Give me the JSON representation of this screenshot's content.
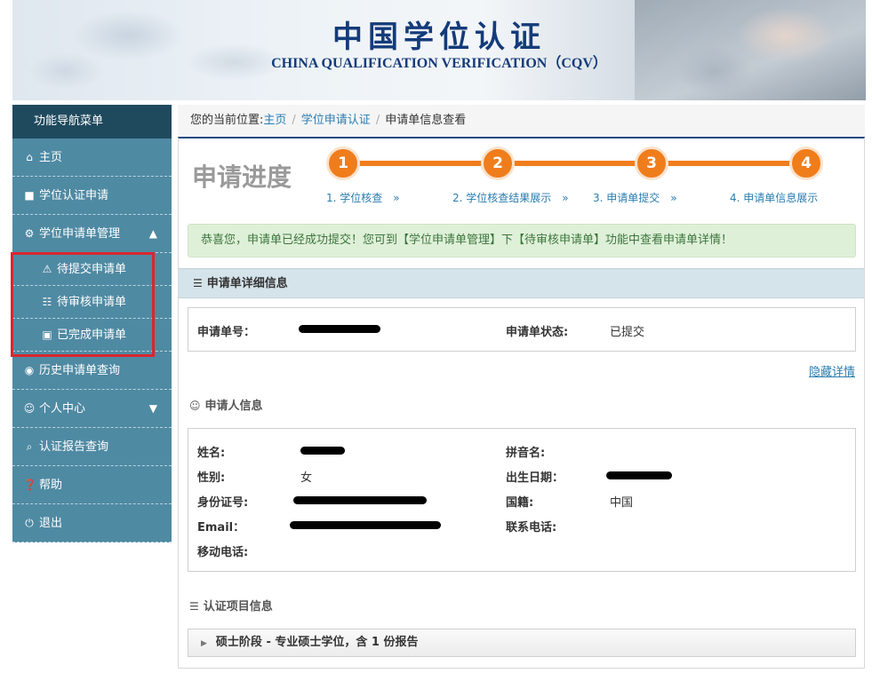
{
  "banner": {
    "title_cn": "中国学位认证",
    "title_en": "CHINA QUALIFICATION VERIFICATION（CQV）"
  },
  "sidebar": {
    "header": "功能导航菜单",
    "items": [
      {
        "label": "主页",
        "icon": "home-icon"
      },
      {
        "label": "学位认证申请",
        "icon": "file-icon"
      },
      {
        "label": "学位申请单管理",
        "icon": "gear-icon"
      },
      {
        "label": "历史申请单查询",
        "icon": "camera-icon"
      },
      {
        "label": "个人中心",
        "icon": "user-icon"
      },
      {
        "label": "认证报告查询",
        "icon": "search-icon"
      },
      {
        "label": "帮助",
        "icon": "question-icon"
      },
      {
        "label": "退出",
        "icon": "power-icon"
      }
    ],
    "subitems": [
      {
        "label": "待提交申请单",
        "icon": "warning-icon"
      },
      {
        "label": "待审核申请单",
        "icon": "cart-icon"
      },
      {
        "label": "已完成申请单",
        "icon": "briefcase-icon"
      }
    ]
  },
  "breadcrumb": {
    "prefix": "您的当前位置:",
    "home": "主页",
    "level2": "学位申请认证",
    "current": "申请单信息查看",
    "separator": "/"
  },
  "progress": {
    "title": "申请进度",
    "steps": [
      {
        "num": "1",
        "label": "1. 学位核查　»"
      },
      {
        "num": "2",
        "label": "2. 学位核查结果展示　»"
      },
      {
        "num": "3",
        "label": "3. 申请单提交　»"
      },
      {
        "num": "4",
        "label": "4. 申请单信息展示"
      }
    ],
    "color": "#f07d1c"
  },
  "alert": "恭喜您，申请单已经成功提交！您可到【学位申请单管理】下【待审核申请单】功能中查看申请单详情！",
  "detail": {
    "section_title": "申请单详细信息",
    "order_no_label": "申请单号：",
    "status_label": "申请单状态:",
    "status_value": "已提交",
    "hide_link": "隐藏详情"
  },
  "applicant": {
    "title": "申请人信息",
    "fields": {
      "name_label": "姓名:",
      "pinyin_label": "拼音名:",
      "gender_label": "性别:",
      "gender_value": "女",
      "birth_label": "出生日期：",
      "id_label": "身份证号:",
      "nationality_label": "国籍:",
      "nationality_value": "中国",
      "email_label": "Email：",
      "phone_label": "联系电话:",
      "mobile_label": "移动电话:"
    }
  },
  "cert_items": {
    "title": "认证项目信息",
    "accordion": "硕士阶段 - 专业硕士学位，含 1 份报告"
  }
}
